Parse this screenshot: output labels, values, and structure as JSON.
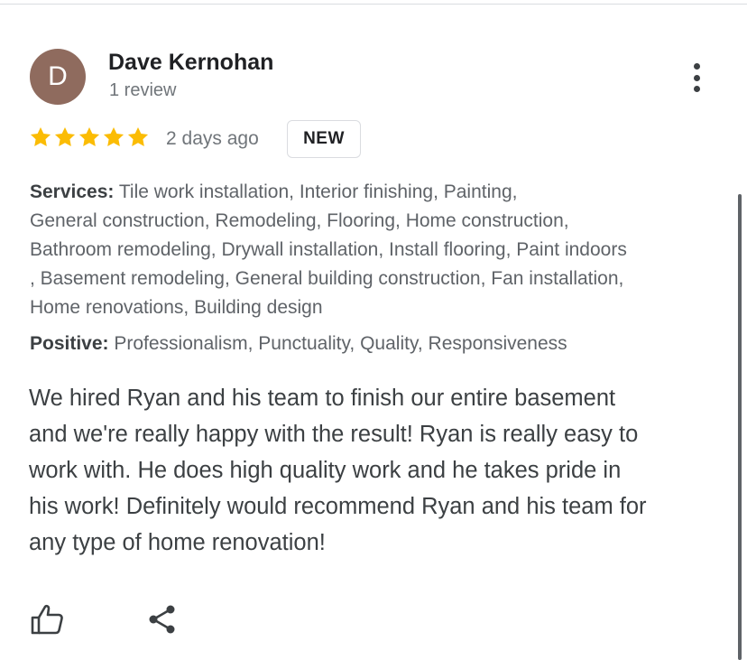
{
  "reviewer": {
    "initial": "D",
    "name": "Dave Kernohan",
    "review_count": "1 review",
    "avatar_color": "#8f6b5e"
  },
  "rating": {
    "stars": 5,
    "max": 5,
    "star_color": "#fbbc04",
    "date": "2 days ago",
    "badge": "NEW"
  },
  "services": {
    "label": "Services:",
    "lines": [
      " Tile work installation, Interior finishing, Painting,",
      "General construction, Remodeling, Flooring, Home construction,",
      "Bathroom remodeling, Drywall installation, Install flooring, Paint indoors",
      ", Basement remodeling, General building construction, Fan installation,",
      "Home renovations, Building design"
    ]
  },
  "positive": {
    "label": "Positive:",
    "value": " Professionalism, Punctuality, Quality, Responsiveness"
  },
  "review": {
    "lines": [
      "We hired Ryan and his team to finish our entire basement",
      "and we're really happy with the result! Ryan is really easy to",
      "work with. He does high quality work and he takes pride in",
      "his work! Definitely would recommend Ryan and his team for",
      "any type of home renovation!"
    ]
  },
  "actions": {
    "like_icon": "thumbs-up-icon",
    "share_icon": "share-icon"
  }
}
